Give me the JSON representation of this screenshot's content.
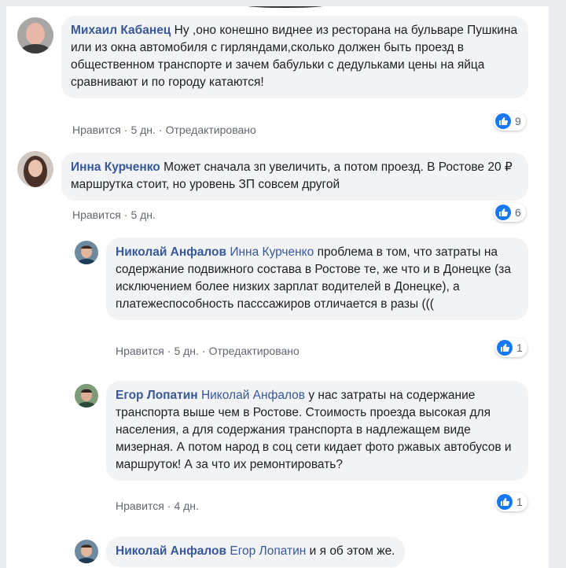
{
  "colors": {
    "name": "#385898",
    "bubble": "#f2f3f5",
    "like_blue": "#1877f2",
    "meta": "#616770"
  },
  "comments": [
    {
      "author": "Михаил Кабанец",
      "mention": "",
      "text": " Ну ,оно конешно виднее из ресторана на бульваре Пушкина или из окна автомобиля с гирляндами,сколько должен быть проезд в общественном транспорте и зачем бабульки с дедульками цены на яйца сравнивают и по городу катаются!",
      "like_label": "Нравится",
      "time": "5 дн.",
      "edited": "Отредактировано",
      "reactions": "9"
    },
    {
      "author": "Инна Курченко",
      "mention": "",
      "text": " Может сначала зп увеличить, а потом проезд. В Ростове 20 ₽ маршрутка стоит, но уровень ЗП совсем другой",
      "like_label": "Нравится",
      "time": "5 дн.",
      "edited": "",
      "reactions": "6"
    },
    {
      "author": "Николай Анфалов",
      "mention": "Инна Курченко",
      "text": " проблема в том, что затраты на содержание подвижного состава в Ростове те, же что и в Донецке (за исключением более низких зарплат водителей в Донецке), а платежеспособность пасссажиров отличается в разы (((",
      "like_label": "Нравится",
      "time": "5 дн.",
      "edited": "Отредактировано",
      "reactions": "1"
    },
    {
      "author": "Егор Лопатин",
      "mention": "Николай Анфалов",
      "text": " у нас затраты на содержание транспорта выше чем в Ростове. Стоимость проезда высокая для населения, а для содержания транспорта в надлежащем виде мизерная. А потом народ в соц сети кидает фото ржавых автобусов и маршруток! А за что их ремонтировать?",
      "like_label": "Нравится",
      "time": "4 дн.",
      "edited": "",
      "reactions": "1"
    },
    {
      "author": "Николай Анфалов",
      "mention": "Егор Лопатин",
      "text": " и я об этом же.",
      "like_label": "",
      "time": "",
      "edited": "",
      "reactions": ""
    }
  ]
}
